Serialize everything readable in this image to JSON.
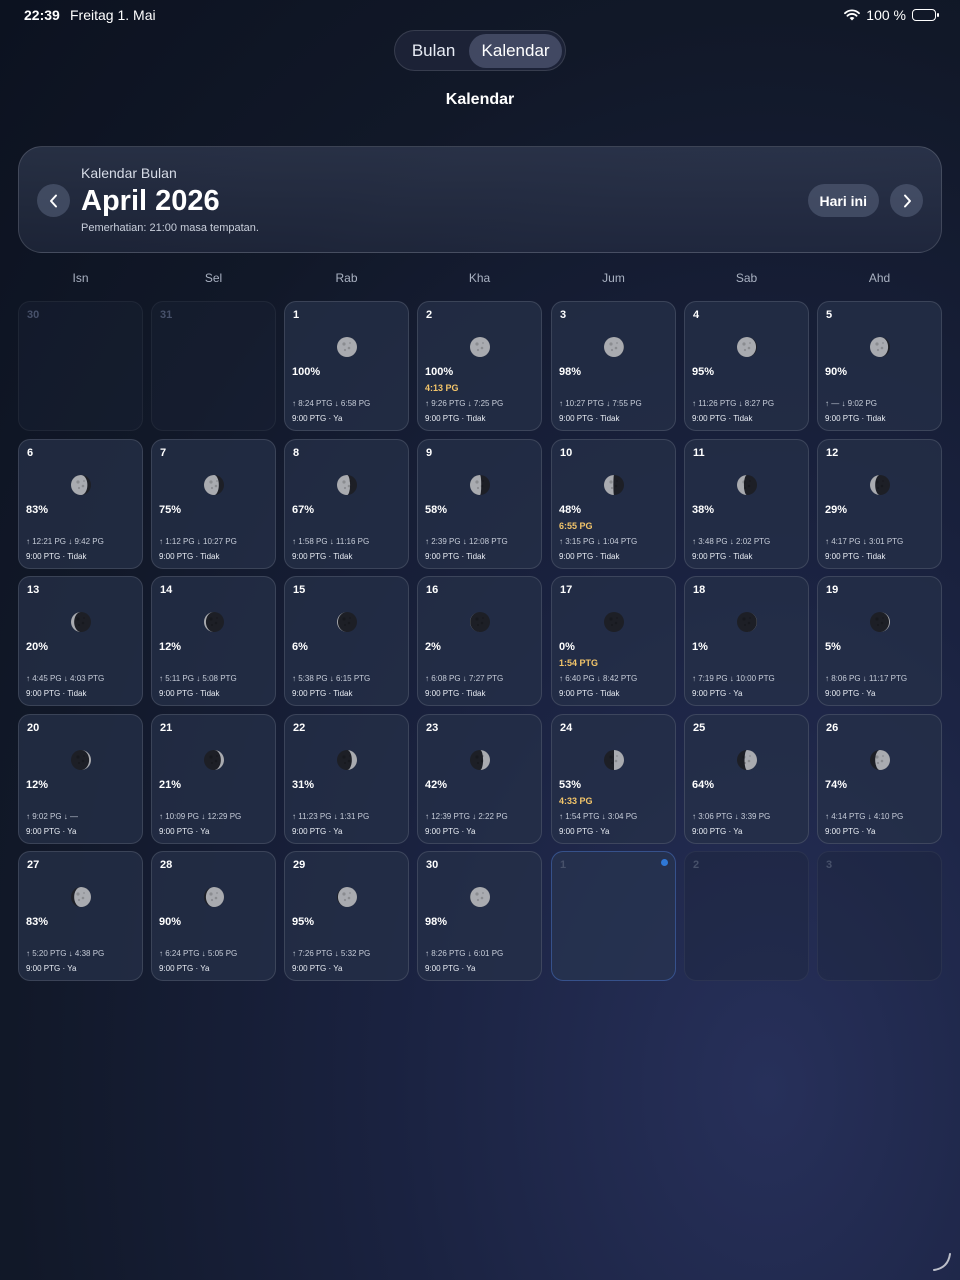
{
  "status": {
    "time": "22:39",
    "date": "Freitag 1. Mai",
    "battery": "100 %"
  },
  "segments": [
    "Bulan",
    "Kalendar"
  ],
  "page_title": "Kalendar",
  "header": {
    "subtitle": "Kalendar Bulan",
    "title": "April 2026",
    "note": "Pemerhatian: 21:00 masa tempatan.",
    "today_label": "Hari ini"
  },
  "weekdays": [
    "Isn",
    "Sel",
    "Rab",
    "Kha",
    "Jum",
    "Sab",
    "Ahd"
  ],
  "cells": [
    {
      "day": "30",
      "other": true
    },
    {
      "day": "31",
      "other": true
    },
    {
      "day": "1",
      "pct": "100%",
      "peak": "",
      "rs": "↑ 8:24 PTG ↓ 6:58 PG",
      "obs": "9:00 PTG · Ya",
      "phase": 0.5,
      "dir": "wax"
    },
    {
      "day": "2",
      "pct": "100%",
      "peak": "4:13 PG",
      "rs": "↑ 9:26 PTG ↓ 7:25 PG",
      "obs": "9:00 PTG · Tidak",
      "phase": 0.5,
      "dir": "wax"
    },
    {
      "day": "3",
      "pct": "98%",
      "peak": "",
      "rs": "↑ 10:27 PTG ↓ 7:55 PG",
      "obs": "9:00 PTG · Tidak",
      "phase": 0.53,
      "dir": "wan"
    },
    {
      "day": "4",
      "pct": "95%",
      "peak": "",
      "rs": "↑ 11:26 PTG ↓ 8:27 PG",
      "obs": "9:00 PTG · Tidak",
      "phase": 0.57,
      "dir": "wan"
    },
    {
      "day": "5",
      "pct": "90%",
      "peak": "",
      "rs": "↑ — ↓ 9:02 PG",
      "obs": "9:00 PTG · Tidak",
      "phase": 0.6,
      "dir": "wan"
    },
    {
      "day": "6",
      "pct": "83%",
      "peak": "",
      "rs": "↑ 12:21 PG ↓ 9:42 PG",
      "obs": "9:00 PTG · Tidak",
      "phase": 0.64,
      "dir": "wan"
    },
    {
      "day": "7",
      "pct": "75%",
      "peak": "",
      "rs": "↑ 1:12 PG ↓ 10:27 PG",
      "obs": "9:00 PTG · Tidak",
      "phase": 0.67,
      "dir": "wan"
    },
    {
      "day": "8",
      "pct": "67%",
      "peak": "",
      "rs": "↑ 1:58 PG ↓ 11:16 PG",
      "obs": "9:00 PTG · Tidak",
      "phase": 0.7,
      "dir": "wan"
    },
    {
      "day": "9",
      "pct": "58%",
      "peak": "",
      "rs": "↑ 2:39 PG ↓ 12:08 PTG",
      "obs": "9:00 PTG · Tidak",
      "phase": 0.73,
      "dir": "wan"
    },
    {
      "day": "10",
      "pct": "48%",
      "peak": "6:55 PG",
      "rs": "↑ 3:15 PG ↓ 1:04 PTG",
      "obs": "9:00 PTG · Tidak",
      "phase": 0.76,
      "dir": "wan"
    },
    {
      "day": "11",
      "pct": "38%",
      "peak": "",
      "rs": "↑ 3:48 PG ↓ 2:02 PTG",
      "obs": "9:00 PTG · Tidak",
      "phase": 0.8,
      "dir": "wan"
    },
    {
      "day": "12",
      "pct": "29%",
      "peak": "",
      "rs": "↑ 4:17 PG ↓ 3:01 PTG",
      "obs": "9:00 PTG · Tidak",
      "phase": 0.83,
      "dir": "wan"
    },
    {
      "day": "13",
      "pct": "20%",
      "peak": "",
      "rs": "↑ 4:45 PG ↓ 4:03 PTG",
      "obs": "9:00 PTG · Tidak",
      "phase": 0.87,
      "dir": "wan"
    },
    {
      "day": "14",
      "pct": "12%",
      "peak": "",
      "rs": "↑ 5:11 PG ↓ 5:08 PTG",
      "obs": "9:00 PTG · Tidak",
      "phase": 0.9,
      "dir": "wan"
    },
    {
      "day": "15",
      "pct": "6%",
      "peak": "",
      "rs": "↑ 5:38 PG ↓ 6:15 PTG",
      "obs": "9:00 PTG · Tidak",
      "phase": 0.93,
      "dir": "wan"
    },
    {
      "day": "16",
      "pct": "2%",
      "peak": "",
      "rs": "↑ 6:08 PG ↓ 7:27 PTG",
      "obs": "9:00 PTG · Tidak",
      "phase": 0.97,
      "dir": "wan"
    },
    {
      "day": "17",
      "pct": "0%",
      "peak": "1:54 PTG",
      "rs": "↑ 6:40 PG ↓ 8:42 PTG",
      "obs": "9:00 PTG · Tidak",
      "phase": 1.0,
      "dir": "wan"
    },
    {
      "day": "18",
      "pct": "1%",
      "peak": "",
      "rs": "↑ 7:19 PG ↓ 10:00 PTG",
      "obs": "9:00 PTG · Ya",
      "phase": 0.03,
      "dir": "wax"
    },
    {
      "day": "19",
      "pct": "5%",
      "peak": "",
      "rs": "↑ 8:06 PG ↓ 11:17 PTG",
      "obs": "9:00 PTG · Ya",
      "phase": 0.07,
      "dir": "wax"
    },
    {
      "day": "20",
      "pct": "12%",
      "peak": "",
      "rs": "↑ 9:02 PG ↓ —",
      "obs": "9:00 PTG · Ya",
      "phase": 0.1,
      "dir": "wax"
    },
    {
      "day": "21",
      "pct": "21%",
      "peak": "",
      "rs": "↑ 10:09 PG ↓ 12:29 PG",
      "obs": "9:00 PTG · Ya",
      "phase": 0.13,
      "dir": "wax"
    },
    {
      "day": "22",
      "pct": "31%",
      "peak": "",
      "rs": "↑ 11:23 PG ↓ 1:31 PG",
      "obs": "9:00 PTG · Ya",
      "phase": 0.17,
      "dir": "wax"
    },
    {
      "day": "23",
      "pct": "42%",
      "peak": "",
      "rs": "↑ 12:39 PTG ↓ 2:22 PG",
      "obs": "9:00 PTG · Ya",
      "phase": 0.2,
      "dir": "wax"
    },
    {
      "day": "24",
      "pct": "53%",
      "peak": "4:33 PG",
      "rs": "↑ 1:54 PTG ↓ 3:04 PG",
      "obs": "9:00 PTG · Ya",
      "phase": 0.25,
      "dir": "wax"
    },
    {
      "day": "25",
      "pct": "64%",
      "peak": "",
      "rs": "↑ 3:06 PTG ↓ 3:39 PG",
      "obs": "9:00 PTG · Ya",
      "phase": 0.29,
      "dir": "wax"
    },
    {
      "day": "26",
      "pct": "74%",
      "peak": "",
      "rs": "↑ 4:14 PTG ↓ 4:10 PG",
      "obs": "9:00 PTG · Ya",
      "phase": 0.33,
      "dir": "wax"
    },
    {
      "day": "27",
      "pct": "83%",
      "peak": "",
      "rs": "↑ 5:20 PTG ↓ 4:38 PG",
      "obs": "9:00 PTG · Ya",
      "phase": 0.37,
      "dir": "wax"
    },
    {
      "day": "28",
      "pct": "90%",
      "peak": "",
      "rs": "↑ 6:24 PTG ↓ 5:05 PG",
      "obs": "9:00 PTG · Ya",
      "phase": 0.4,
      "dir": "wax"
    },
    {
      "day": "29",
      "pct": "95%",
      "peak": "",
      "rs": "↑ 7:26 PTG ↓ 5:32 PG",
      "obs": "9:00 PTG · Ya",
      "phase": 0.43,
      "dir": "wax"
    },
    {
      "day": "30",
      "pct": "98%",
      "peak": "",
      "rs": "↑ 8:26 PTG ↓ 6:01 PG",
      "obs": "9:00 PTG · Ya",
      "phase": 0.47,
      "dir": "wax"
    },
    {
      "day": "1",
      "other": true,
      "today": true
    },
    {
      "day": "2",
      "other": true
    },
    {
      "day": "3",
      "other": true
    }
  ]
}
